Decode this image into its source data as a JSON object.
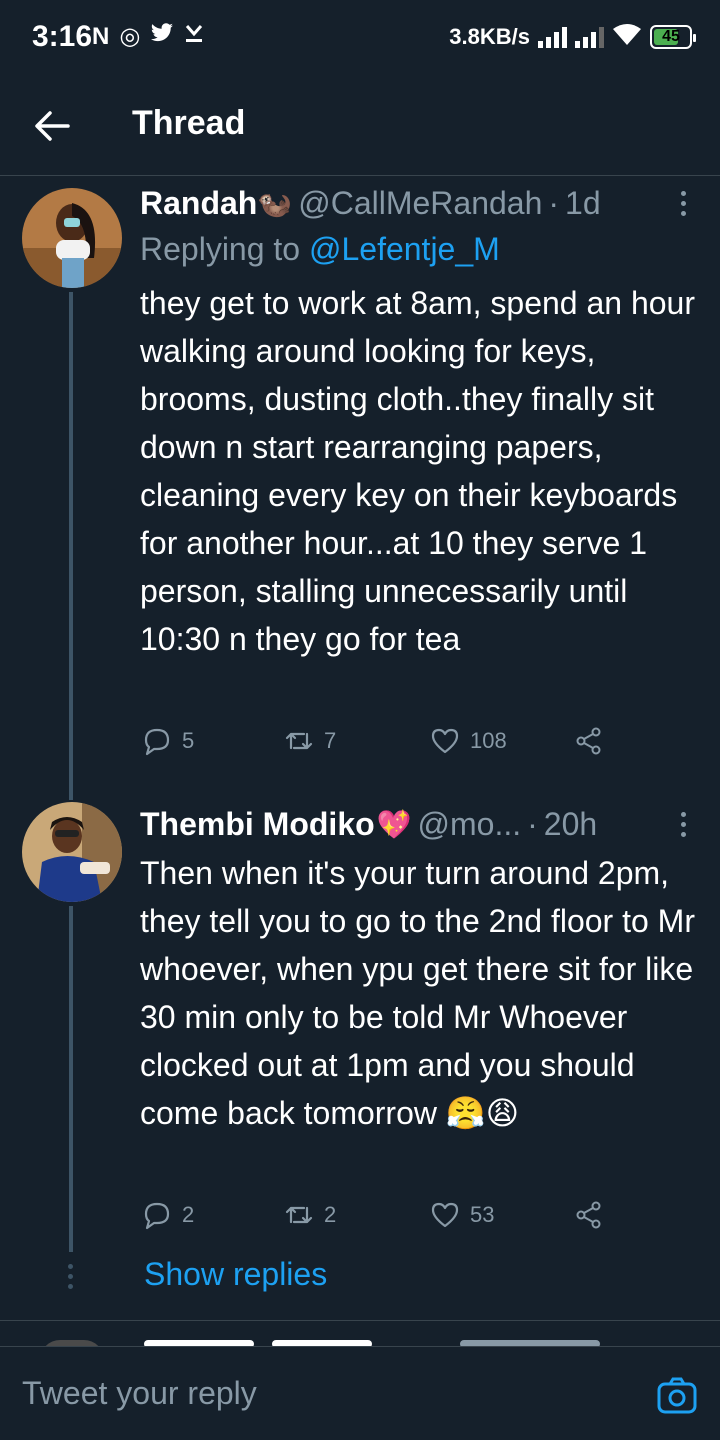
{
  "status_bar": {
    "time": "3:16",
    "left_icons": [
      "N",
      "◎",
      "𝕥",
      "⤓"
    ],
    "speed": "3.8KB/s",
    "battery": "45"
  },
  "header": {
    "title": "Thread",
    "back_icon": "arrow-left-icon"
  },
  "tweets": [
    {
      "name": "Randah",
      "name_emoji": "🦦",
      "handle": "@CallMeRandah",
      "time": "1d",
      "replying_label": "Replying to",
      "replying_to": "@Lefentje_M",
      "text": "they get to work at 8am, spend an hour walking around looking for keys, brooms, dusting cloth..they finally sit down n start rearranging papers, cleaning every key on their keyboards for another hour...at 10 they serve 1 person, stalling unnecessarily until 10:30 n they go for tea",
      "replies": "5",
      "retweets": "7",
      "likes": "108"
    },
    {
      "name": "Thembi Modiko",
      "name_emoji": "💖",
      "handle": "@mo...",
      "time": "20h",
      "text": "Then when it's your turn around 2pm, they tell you to go to the 2nd floor to Mr whoever, when ypu get there sit for like 30 min only to be told Mr Whoever clocked out at 1pm and you should come back tomorrow 😤😩",
      "replies": "2",
      "retweets": "2",
      "likes": "53"
    }
  ],
  "show_replies": "Show replies",
  "reply_bar": {
    "placeholder": "Tweet your reply"
  },
  "colors": {
    "background": "#15202b",
    "accent": "#1da1f2",
    "muted": "#8899a6",
    "divider": "#38444d"
  }
}
